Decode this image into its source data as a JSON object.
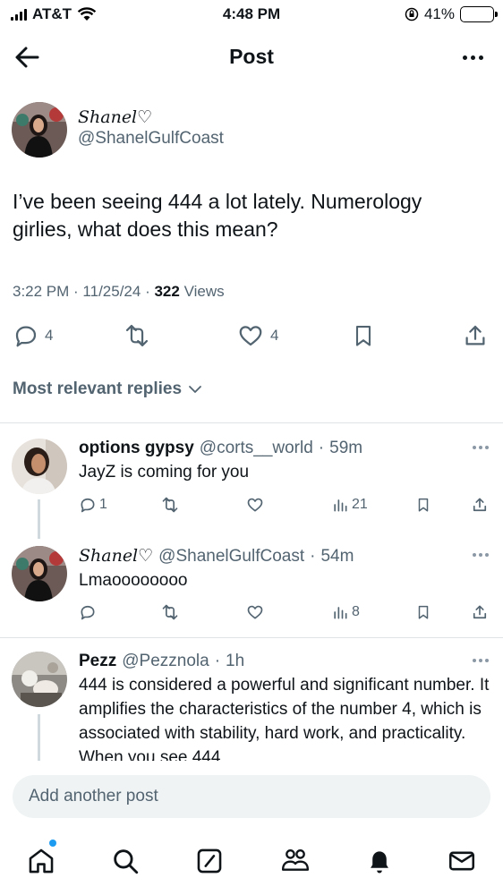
{
  "status_bar": {
    "carrier": "AT&T",
    "time": "4:48 PM",
    "battery": "41%"
  },
  "header": {
    "title": "Post"
  },
  "post": {
    "display_name": "Shanel♡",
    "handle": "@ShanelGulfCoast",
    "text": "I’ve been seeing 444 a lot lately. Numerology girlies, what does this mean?",
    "time": "3:22 PM",
    "date": "11/25/24",
    "views_count": "322",
    "views_label": "Views",
    "replies": "4",
    "likes": "4"
  },
  "sort_label": "Most relevant replies",
  "replies": [
    {
      "name": "options gypsy",
      "handle": "@corts__world",
      "age": "59m",
      "text": "JayZ is coming for you",
      "replies": "1",
      "views": "21"
    },
    {
      "name": "Shanel♡",
      "handle": "@ShanelGulfCoast",
      "age": "54m",
      "text": "Lmaoooooooo",
      "views": "8"
    },
    {
      "name": "Pezz",
      "handle": "@Pezznola",
      "age": "1h",
      "text": "444 is considered a powerful and significant number. It amplifies the characteristics of the number 4, which is associated with stability, hard work, and practicality. When you see 444"
    }
  ],
  "compose_placeholder": "Add another post",
  "accent": "#1d9bf0"
}
